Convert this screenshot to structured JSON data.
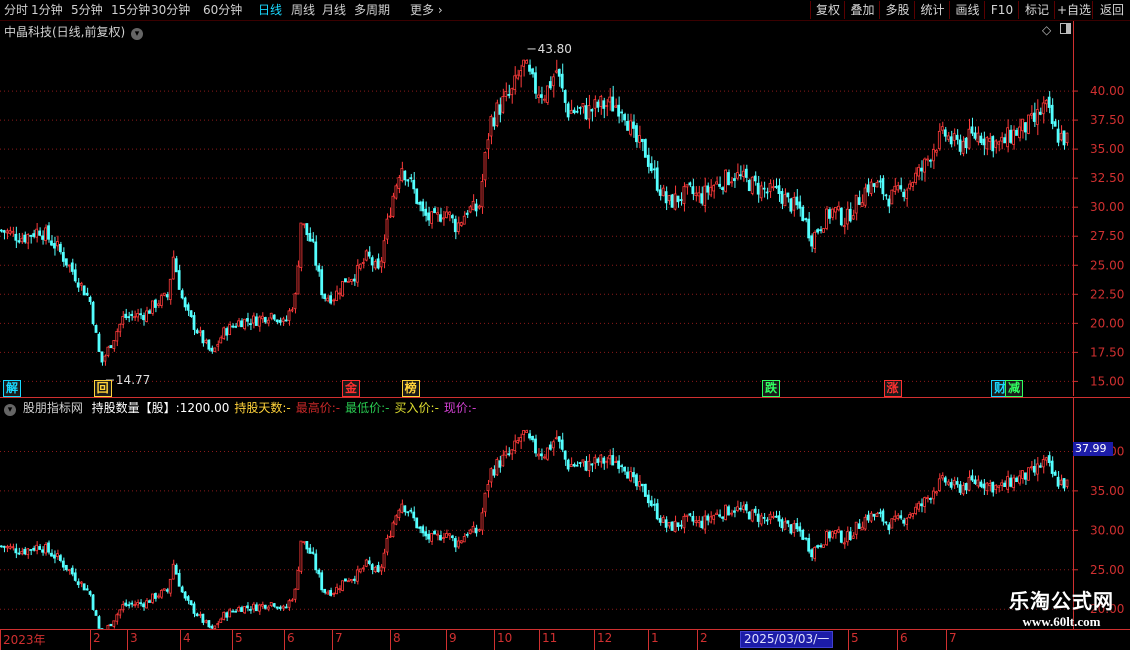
{
  "toolbar": {
    "periods": [
      {
        "label": "分时",
        "active": false
      },
      {
        "label": "1分钟",
        "active": false
      },
      {
        "label": "5分钟",
        "active": false
      },
      {
        "label": "15分钟",
        "active": false
      },
      {
        "label": "30分钟",
        "active": false
      },
      {
        "label": "60分钟",
        "active": false
      },
      {
        "label": "日线",
        "active": true
      },
      {
        "label": "周线",
        "active": false
      },
      {
        "label": "月线",
        "active": false
      },
      {
        "label": "多周期",
        "active": false
      }
    ],
    "more": "更多",
    "more_icon": "chevron-right-icon",
    "right_buttons": [
      "复权",
      "叠加",
      "多股",
      "统计",
      "画线",
      "F10",
      "标记",
      "+自选",
      "返回"
    ]
  },
  "main_chart": {
    "title": "中晶科技(日线,前复权)",
    "title_icon": "chevron-down-icon",
    "corner_icons": [
      "diamond-icon",
      "panel-toggle-icon"
    ],
    "max_label": "43.80",
    "min_label": "14.77",
    "signals": [
      {
        "text": "解",
        "color": "#19d9ff",
        "pos": 0.0
      },
      {
        "text": "回",
        "color": "#ffd23a",
        "pos": 0.085
      },
      {
        "text": "金",
        "color": "#ff3030",
        "pos": 0.318
      },
      {
        "text": "榜",
        "color": "#ffd23a",
        "pos": 0.374
      },
      {
        "text": "跌",
        "color": "#30ff60",
        "pos": 0.712
      },
      {
        "text": "涨",
        "color": "#ff3030",
        "pos": 0.826
      },
      {
        "text": "财",
        "color": "#19d9ff",
        "pos": 0.927
      },
      {
        "text": "减",
        "color": "#30ff60",
        "pos": 0.94
      }
    ]
  },
  "sub_chart": {
    "title_icon": "chevron-down-icon",
    "name": "股朋指标网",
    "fields": [
      {
        "label": "持股数量【股】:",
        "value": "1200.00",
        "color": "#ffffff"
      },
      {
        "label": "持股天数:",
        "value": "-",
        "color": "#ffd23a"
      },
      {
        "label": "最高价:",
        "value": "-",
        "color": "#c82828"
      },
      {
        "label": "最低价:",
        "value": "-",
        "color": "#28c850"
      },
      {
        "label": "买入价:",
        "value": "-",
        "color": "#e0e030"
      },
      {
        "label": "现价:",
        "value": "-",
        "color": "#d040d0"
      }
    ],
    "current_price_tag": "37.99"
  },
  "x_axis": {
    "labels": [
      "2023年",
      "2",
      "3",
      "4",
      "5",
      "6",
      "7",
      "8",
      "9",
      "10",
      "11",
      "12",
      "1",
      "2",
      "5",
      "6",
      "7"
    ],
    "date_box": "2025/03/03/一"
  },
  "watermark": {
    "line1": "乐淘公式网",
    "line2": "www.60lt.com"
  },
  "colors": {
    "up": "#ff3b3b",
    "down": "#54ffff",
    "grid": "#8b1a1a",
    "axis": "#d03030"
  },
  "chart_data": {
    "type": "candlestick",
    "y_ticks": [
      15.0,
      17.5,
      20.0,
      22.5,
      25.0,
      27.5,
      30.0,
      32.5,
      35.0,
      37.5,
      40.0
    ],
    "ylim": [
      14.0,
      45.0
    ],
    "sub_y_ticks": [
      20.0,
      25.0,
      30.0,
      35.0,
      40.0
    ],
    "sub_ylim": [
      18.0,
      45.0
    ],
    "close_path": [
      [
        0,
        28
      ],
      [
        0.02,
        27.4
      ],
      [
        0.035,
        28.1
      ],
      [
        0.05,
        26.6
      ],
      [
        0.065,
        24.4
      ],
      [
        0.08,
        22
      ],
      [
        0.09,
        16.5
      ],
      [
        0.1,
        18.5
      ],
      [
        0.11,
        20.5
      ],
      [
        0.13,
        20.8
      ],
      [
        0.14,
        21.8
      ],
      [
        0.15,
        22.3
      ],
      [
        0.155,
        25.8
      ],
      [
        0.165,
        21.3
      ],
      [
        0.18,
        18.8
      ],
      [
        0.19,
        17.3
      ],
      [
        0.2,
        19.2
      ],
      [
        0.215,
        20.2
      ],
      [
        0.23,
        20.3
      ],
      [
        0.245,
        20.9
      ],
      [
        0.255,
        19.9
      ],
      [
        0.265,
        22.3
      ],
      [
        0.27,
        28.8
      ],
      [
        0.28,
        26.8
      ],
      [
        0.29,
        22.3
      ],
      [
        0.3,
        22.3
      ],
      [
        0.31,
        23.8
      ],
      [
        0.32,
        24.3
      ],
      [
        0.33,
        25.8
      ],
      [
        0.34,
        24.3
      ],
      [
        0.35,
        29.8
      ],
      [
        0.36,
        33.8
      ],
      [
        0.37,
        31.8
      ],
      [
        0.38,
        29.3
      ],
      [
        0.39,
        28.8
      ],
      [
        0.4,
        29.8
      ],
      [
        0.41,
        28.3
      ],
      [
        0.42,
        29.8
      ],
      [
        0.43,
        29.8
      ],
      [
        0.44,
        37.3
      ],
      [
        0.45,
        38.8
      ],
      [
        0.46,
        39.8
      ],
      [
        0.47,
        42.3
      ],
      [
        0.48,
        40.3
      ],
      [
        0.49,
        39.8
      ],
      [
        0.5,
        41.8
      ],
      [
        0.51,
        38.3
      ],
      [
        0.52,
        38.3
      ],
      [
        0.53,
        38.3
      ],
      [
        0.54,
        38.8
      ],
      [
        0.55,
        38.8
      ],
      [
        0.56,
        38.8
      ],
      [
        0.57,
        35.8
      ],
      [
        0.58,
        34.8
      ],
      [
        0.59,
        32.3
      ],
      [
        0.6,
        30.3
      ],
      [
        0.61,
        30.8
      ],
      [
        0.62,
        31.3
      ],
      [
        0.63,
        30.8
      ],
      [
        0.64,
        31.8
      ],
      [
        0.65,
        32.3
      ],
      [
        0.66,
        32.8
      ],
      [
        0.67,
        32.3
      ],
      [
        0.68,
        31.8
      ],
      [
        0.69,
        31.3
      ],
      [
        0.7,
        31.3
      ],
      [
        0.71,
        30.3
      ],
      [
        0.72,
        29.8
      ],
      [
        0.73,
        27.3
      ],
      [
        0.74,
        28.8
      ],
      [
        0.75,
        29.8
      ],
      [
        0.76,
        28.8
      ],
      [
        0.77,
        30.3
      ],
      [
        0.78,
        31.8
      ],
      [
        0.79,
        31.8
      ],
      [
        0.8,
        30.8
      ],
      [
        0.81,
        31.3
      ],
      [
        0.82,
        32.3
      ],
      [
        0.83,
        33.3
      ],
      [
        0.84,
        35.3
      ],
      [
        0.85,
        36.3
      ],
      [
        0.86,
        35.3
      ],
      [
        0.87,
        35.8
      ],
      [
        0.88,
        36.3
      ],
      [
        0.89,
        35.8
      ],
      [
        0.9,
        35.3
      ],
      [
        0.91,
        36.3
      ],
      [
        0.92,
        36.8
      ],
      [
        0.93,
        37.3
      ],
      [
        0.94,
        38.8
      ],
      [
        0.95,
        36.3
      ],
      [
        0.96,
        35.8
      ]
    ]
  }
}
